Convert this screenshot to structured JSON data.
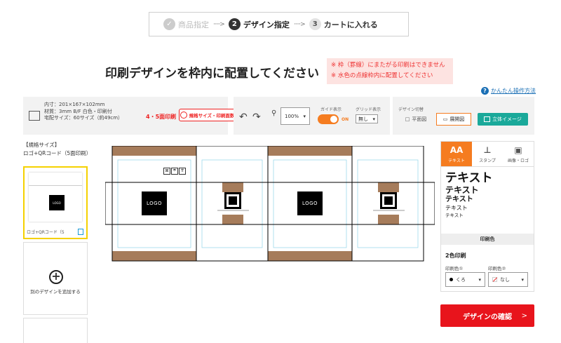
{
  "steps": [
    {
      "num": "✓",
      "label": "商品指定"
    },
    {
      "num": "2",
      "label": "デザイン指定"
    },
    {
      "num": "3",
      "label": "カートに入れる"
    }
  ],
  "step_arrow": "·····>",
  "title": "印刷デザインを枠内に配置してください",
  "notice": [
    "※ 枠（罫線）にまたがる印刷はできません",
    "※ 水色の点線枠内に配置してください"
  ],
  "help": {
    "icon": "?",
    "label": "かんたん操作方法"
  },
  "spec": {
    "lines": [
      "内寸：201×167×102mm",
      "材質：3mm B/F 白色・印刷付",
      "宅配サイズ：60サイズ（約49cm）"
    ],
    "faces": "4・5面印刷",
    "change_button": "規格サイズ・印刷面数変更"
  },
  "toolbar": {
    "undo": "↶",
    "redo": "↷",
    "zoom_icon": "⚲",
    "zoom": "100%",
    "guide_label": "ガイド表示",
    "guide_state": "ON",
    "grid_label": "グリッド表示",
    "grid_value": "無し",
    "design_switch_label": "デザイン切替",
    "flat_view": "平面図",
    "dev_view": "展開図",
    "view_3d": "立体イメージ"
  },
  "left": {
    "heading_1": "【規格サイズ】",
    "heading_2": "ロゴ+QRコード（5面印刷）",
    "thumb_caption": "ロゴ+QRコード（5",
    "thumb_logo": "LOGO",
    "add_design": "別のデザインを追加する",
    "add_icon": "+"
  },
  "canvas": {
    "logo_text": "LOGO",
    "care_icons": [
      "⊠",
      "☂",
      "⇈"
    ]
  },
  "right": {
    "tabs": [
      {
        "icon": "AA",
        "label": "テキスト"
      },
      {
        "icon": "⊥",
        "label": "スタンプ"
      },
      {
        "icon": "▣",
        "label": "画像・ロゴ"
      }
    ],
    "samples": [
      "テキスト",
      "テキスト",
      "テキスト",
      "テキスト",
      "テキスト"
    ],
    "print_color_header": "印刷色",
    "two_color": "2色印刷",
    "color1_label": "印刷色①",
    "color1_value": "くろ",
    "color2_label": "印刷色②",
    "color2_value": "なし",
    "caret": "▾"
  },
  "confirm": {
    "label": "デザインの確認",
    "chevron": ">"
  },
  "colors": {
    "accent": "#f57c20",
    "kraft": "#a67c5b",
    "confirm_red": "#e8141c",
    "teal": "#1aa99a",
    "guide": "#8fd3e8"
  }
}
